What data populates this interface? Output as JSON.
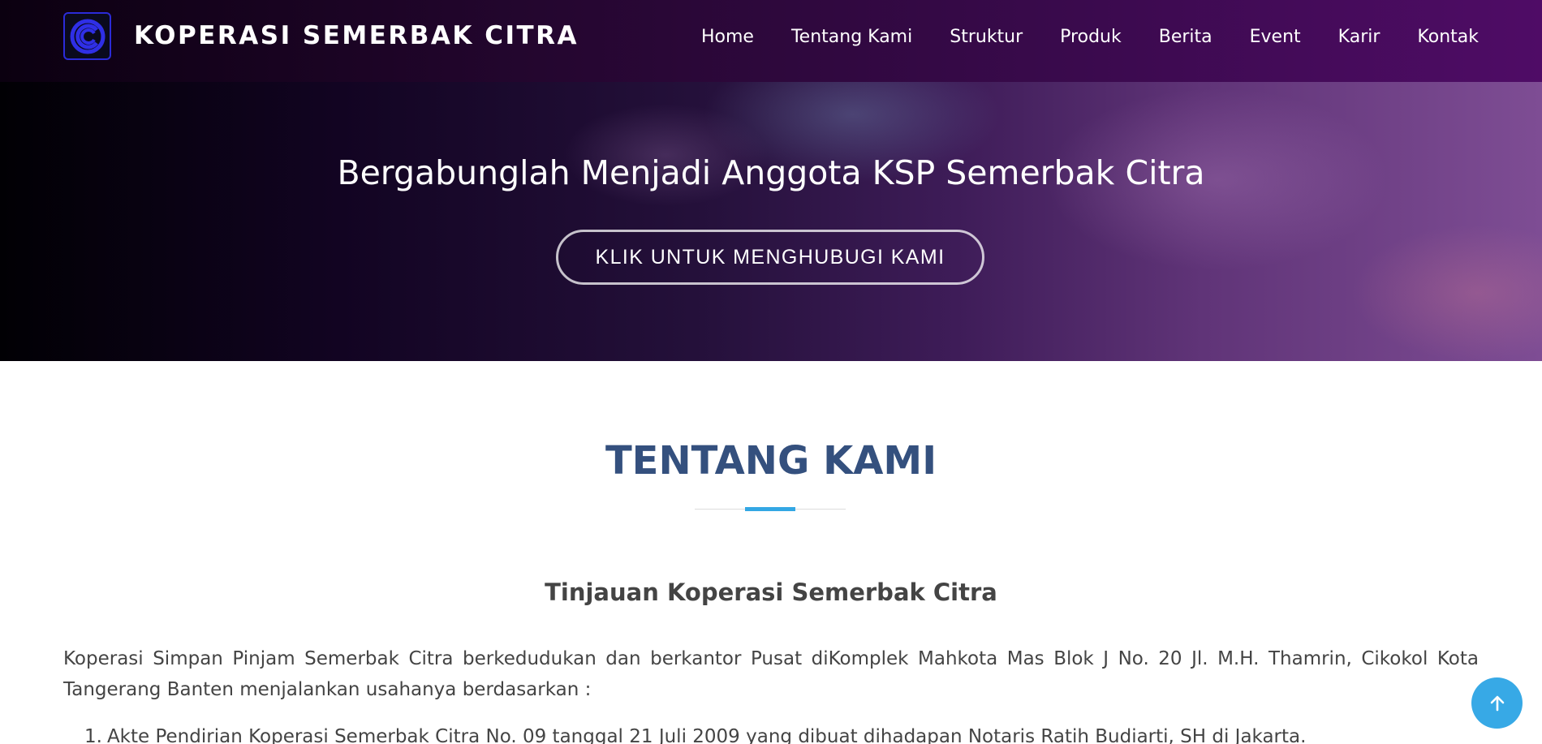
{
  "header": {
    "brand_name": "KOPERASI SEMERBAK CITRA",
    "logo_icon": "cs-logo-icon",
    "nav_items": [
      {
        "label": "Home"
      },
      {
        "label": "Tentang Kami"
      },
      {
        "label": "Struktur"
      },
      {
        "label": "Produk"
      },
      {
        "label": "Berita"
      },
      {
        "label": "Event"
      },
      {
        "label": "Karir"
      },
      {
        "label": "Kontak"
      }
    ]
  },
  "hero": {
    "title": "Bergabunglah Menjadi Anggota KSP Semerbak Citra",
    "button_label": "KLIK UNTUK MENGHUBUGI KAMI"
  },
  "about": {
    "section_title": "TENTANG KAMI",
    "subtitle": "Tinjauan Koperasi Semerbak Citra",
    "paragraph": "Koperasi Simpan Pinjam Semerbak Citra berkedudukan dan berkantor Pusat diKomplek Mahkota Mas Blok J No. 20 Jl. M.H. Thamrin, Cikokol Kota Tangerang Banten menjalankan usahanya berdasarkan :",
    "list": [
      {
        "number": "1.",
        "text": "Akte Pendirian Koperasi Semerbak Citra No. 09 tanggal 21 Juli 2009 yang dibuat dihadapan Notaris Ratih Budiarti, SH di Jakarta."
      }
    ]
  },
  "ui": {
    "back_to_top_icon": "arrow-up-icon"
  },
  "colors": {
    "section_title": "#34507e",
    "accent": "#33a7e4",
    "logo_blue": "#2b2bd8",
    "body_text": "#444444"
  }
}
